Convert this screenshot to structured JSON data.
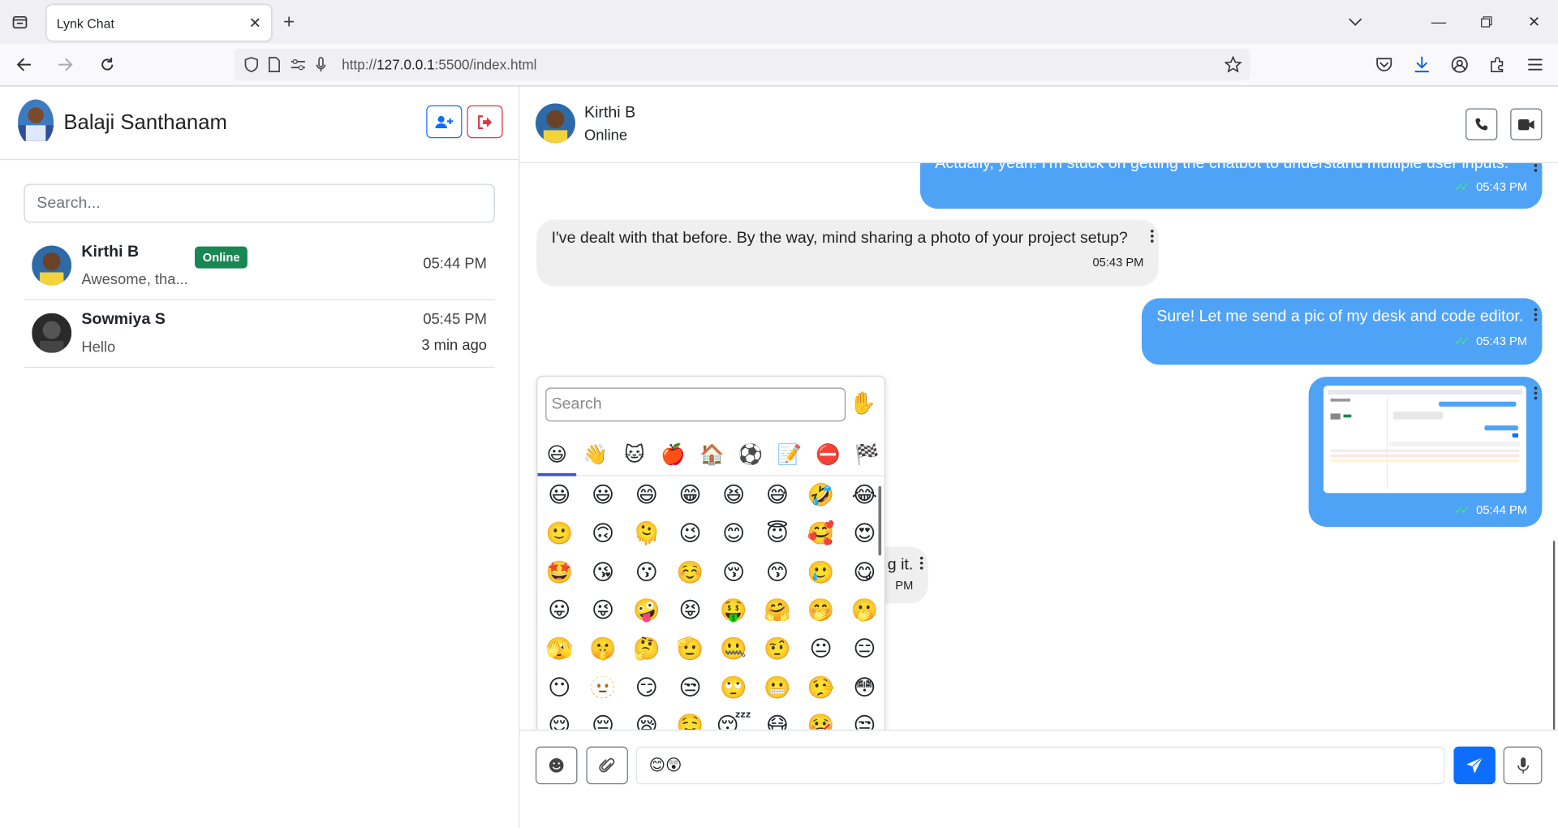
{
  "browser": {
    "tab_title": "Lynk Chat",
    "url_prefix": "http://",
    "url_host": "127.0.0.1",
    "url_rest": ":5500/index.html"
  },
  "sidebar": {
    "user_name": "Balaji Santhanam",
    "search_placeholder": "Search...",
    "contacts": [
      {
        "name": "Kirthi B",
        "badge": "Online",
        "last_message": "Awesome, tha...",
        "time": "05:44 PM"
      },
      {
        "name": "Sowmiya S",
        "last_message": "Hello",
        "time": "05:45 PM",
        "ago": "3 min ago"
      }
    ]
  },
  "chat": {
    "contact_name": "Kirthi B",
    "contact_status": "Online",
    "messages": [
      {
        "direction": "out",
        "text": "Actually, yeah! I'm stuck on getting the chatbot to understand multiple user inputs.",
        "time": "05:43 PM"
      },
      {
        "direction": "in",
        "text": "I've dealt with that before. By the way, mind sharing a photo of your project setup?",
        "time": "05:43 PM"
      },
      {
        "direction": "out",
        "text": "Sure! Let me send a pic of my desk and code editor.",
        "time": "05:43 PM"
      },
      {
        "direction": "out",
        "type": "image",
        "time": "05:44 PM"
      },
      {
        "direction": "in",
        "text_visible": "g it.",
        "time_visible": "PM"
      }
    ]
  },
  "emoji_picker": {
    "search_placeholder": "Search",
    "skin_tone": "✋",
    "categories": [
      "😃",
      "👋",
      "🐱",
      "🍎",
      "🏠",
      "⚽",
      "📝",
      "⛔",
      "🏁"
    ],
    "emojis": [
      "😃",
      "😃",
      "😄",
      "😁",
      "😆",
      "😅",
      "🤣",
      "😂",
      "🙂",
      "🙃",
      "🫠",
      "😉",
      "😊",
      "😇",
      "🥰",
      "😍",
      "🤩",
      "😘",
      "😗",
      "☺️",
      "😚",
      "😙",
      "🥲",
      "😋",
      "😛",
      "😜",
      "🤪",
      "😝",
      "🤑",
      "🤗",
      "🤭",
      "🫢",
      "🫣",
      "🤫",
      "🤔",
      "🫡",
      "🤐",
      "🤨",
      "😐",
      "😑",
      "😶",
      "🫥",
      "😏",
      "😒",
      "🙄",
      "😬",
      "🤥",
      "😳",
      "😌",
      "😔",
      "😪",
      "🤤",
      "😴",
      "😷",
      "🤒",
      "😒"
    ],
    "frequent": [
      "☺️",
      "😊",
      "😒",
      "❤️",
      "👍",
      "😍",
      "😂",
      "😭"
    ]
  },
  "composer": {
    "input_value": "😊😲"
  },
  "colors": {
    "primary": "#0d6efd",
    "danger": "#dc3545",
    "success": "#198754",
    "outgoing_bubble": "#4fa3f7",
    "incoming_bubble": "#efefef"
  }
}
